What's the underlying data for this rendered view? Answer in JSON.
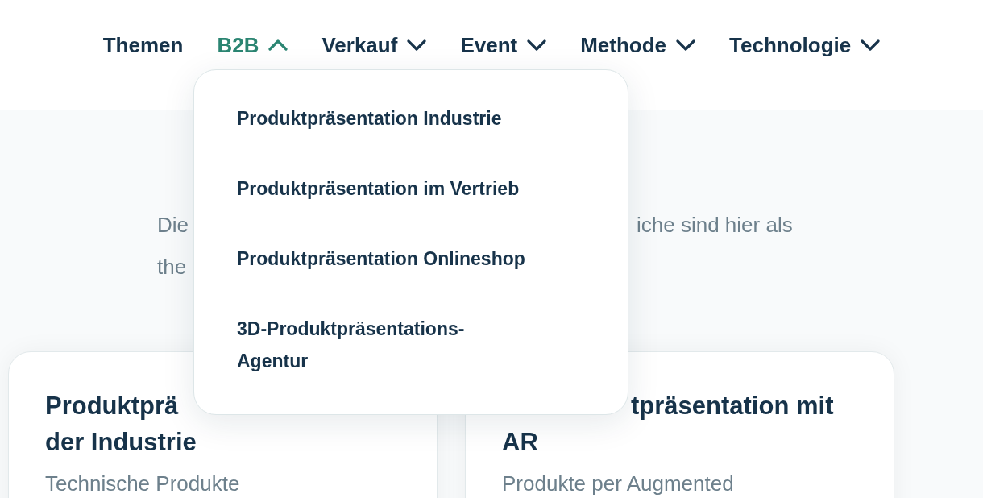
{
  "nav": [
    {
      "label": "Themen",
      "kind": "link",
      "expanded": false
    },
    {
      "label": "B2B",
      "kind": "menu",
      "expanded": true
    },
    {
      "label": "Verkauf",
      "kind": "menu",
      "expanded": false
    },
    {
      "label": "Event",
      "kind": "menu",
      "expanded": false
    },
    {
      "label": "Methode",
      "kind": "menu",
      "expanded": false
    },
    {
      "label": "Technologie",
      "kind": "menu",
      "expanded": false
    }
  ],
  "dropdown": {
    "items": [
      "Produktpräsentation Industrie",
      "Produktpräsentation im Vertrieb",
      "Produktpräsentation Onlineshop",
      "3D-Produktpräsentations-Agentur"
    ]
  },
  "intro": {
    "line_1_start": "Die",
    "line_1_end": "iche sind hier als",
    "line_2_start": "the"
  },
  "cards": [
    {
      "title_line_1": "Produktprä",
      "title_line_2": "der Industrie",
      "text": "Technische Produkte"
    },
    {
      "title_line_1": "tpräsentation mit",
      "title_line_2": "AR",
      "text": "Produkte per Augmented"
    }
  ]
}
